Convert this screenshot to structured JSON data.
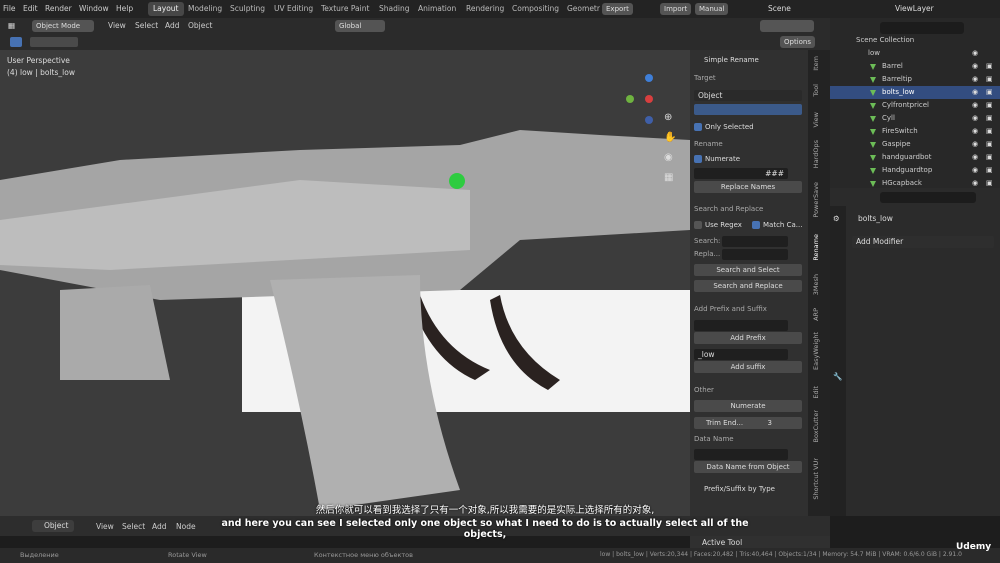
{
  "topbar": {
    "menus": [
      "File",
      "Edit",
      "Render",
      "Window",
      "Help"
    ],
    "workspaces": [
      "Layout",
      "Modeling",
      "Sculpting",
      "UV Editing",
      "Texture Paint",
      "Shading",
      "Animation",
      "Rendering",
      "Compositing",
      "Geometr"
    ],
    "active_workspace": "Layout",
    "export_label": "Export",
    "import_label": "Import",
    "manual_label": "Manual",
    "scene_label": "Scene",
    "viewlayer_label": "ViewLayer"
  },
  "header3d": {
    "mode": "Object Mode",
    "menus": [
      "View",
      "Select",
      "Add",
      "Object"
    ],
    "orientation": "Global",
    "options_label": "Options"
  },
  "viewport": {
    "perspective": "User Perspective",
    "object_info": "(4) low | bolts_low"
  },
  "npanel": {
    "title": "Simple Rename",
    "target_label": "Target",
    "target_value": "Object",
    "only_selected": "Only Selected",
    "rename_label": "Rename",
    "numerate": "Numerate",
    "hash_value": "###",
    "replace_names": "Replace Names",
    "search_replace_label": "Search and Replace",
    "use_regex": "Use Regex",
    "match_case": "Match Ca...",
    "search_label": "Search:",
    "replace_label": "Repla...",
    "search_select_btn": "Search and Select",
    "search_replace_btn": "Search and Replace",
    "prefix_suffix_label": "Add Prefix and Suffix",
    "add_prefix_btn": "Add Prefix",
    "suffix_value": "_low",
    "add_suffix_btn": "Add suffix",
    "other_label": "Other",
    "numerate_btn": "Numerate",
    "trim_end": "Trim End...",
    "trim_value": "3",
    "data_name_label": "Data Name",
    "data_from_object": "Data Name from Object",
    "prefix_suffix_by_type": "Prefix/Suffix by Type"
  },
  "vtabs": [
    "Item",
    "Tool",
    "View",
    "HardOps",
    "PowerSave",
    "Rename",
    "3Mesh",
    "ARP",
    "EasyWeight",
    "Edit",
    "BoxCutter",
    "Shortcut VUr"
  ],
  "outliner": {
    "collection": "Scene Collection",
    "low": "low",
    "items": [
      "Barrel",
      "Barreltip",
      "bolts_low",
      "Cylfrontpricel",
      "Cyll",
      "FireSwitch",
      "Gaspipe",
      "handguardbot",
      "Handguardtop",
      "HGcapback"
    ],
    "selected_index": 2
  },
  "properties": {
    "object_name": "bolts_low",
    "add_modifier": "Add Modifier"
  },
  "timeline": {
    "mode": "Object",
    "menus": [
      "View",
      "Select",
      "Add",
      "Node"
    ],
    "active_tool": "Active Tool"
  },
  "subtitles": {
    "chinese": "然后你就可以看到我选择了只有一个对象,所以我需要的是实际上选择所有的对象,",
    "english": "and here you can see I selected only one object so what I need to do is to actually select all of the objects,"
  },
  "status": {
    "select": "Выделение",
    "rotate": "Rotate View",
    "context": "Контекстное меню объектов",
    "stats": "low | bolts_low | Verts:20,344 | Faces:20,482 | Tris:40,464 | Objects:1/34 | Memory: 54.7 MiB | VRAM: 0.6/6.0 GiB | 2.91.0"
  },
  "watermark": "Udemy",
  "colors": {
    "accent": "#4772b3",
    "mesh_icon": "#6cbd57",
    "cursor": "#2ecc40"
  }
}
